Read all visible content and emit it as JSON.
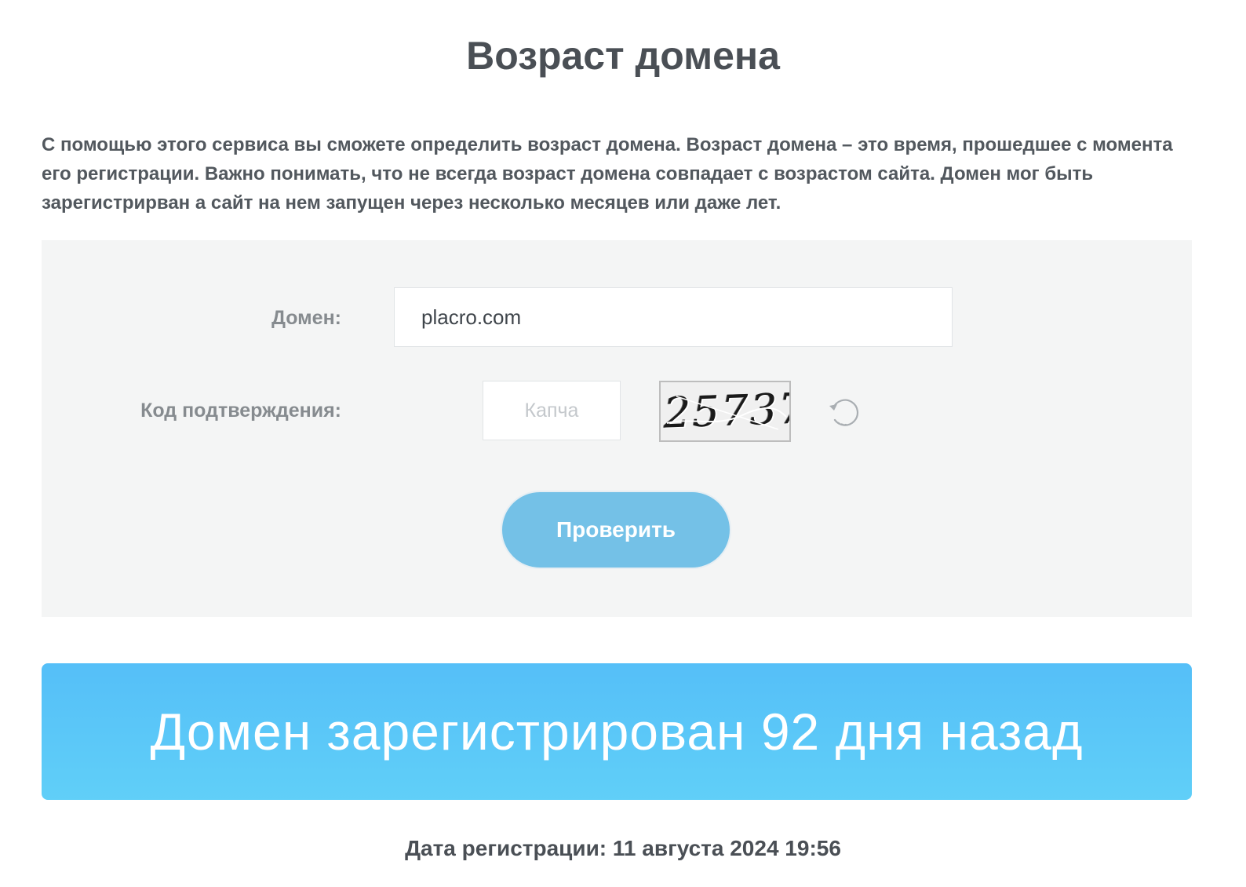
{
  "page": {
    "title": "Возраст домена",
    "intro": "С помощью этого сервиса вы сможете определить возраст домена. Возраст домена – это время, прошедшее с момента его регистрации. Важно понимать, что не всегда возраст домена совпадает с возрастом сайта. Домен мог быть зарегистрирван а сайт на нем запущен через несколько месяцев или даже лет."
  },
  "form": {
    "domain_label": "Домен:",
    "domain_value": "placro.com",
    "code_label": "Код подтверждения:",
    "captcha_placeholder": "Капча",
    "captcha_image_text": "25737",
    "refresh_icon": "refresh-icon",
    "submit_label": "Проверить"
  },
  "result": {
    "message": "Домен зарегистрирован 92 дня назад",
    "registration_date": "Дата регистрации: 11 августа 2024 19:56"
  },
  "colors": {
    "button": "#74c1e7",
    "banner": "#55bff8",
    "panel": "#f4f5f5",
    "text": "#4a4f55"
  }
}
